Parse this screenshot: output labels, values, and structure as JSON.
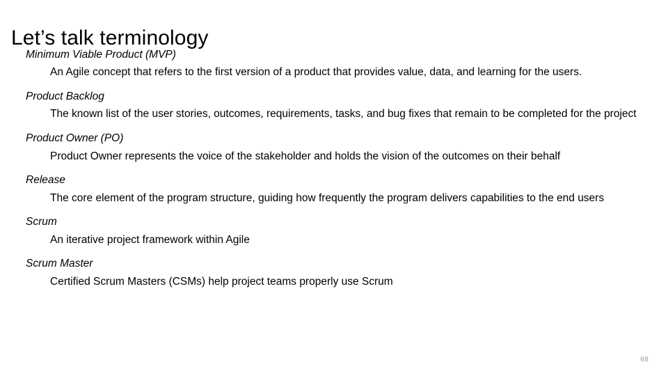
{
  "slide": {
    "title": "Let’s talk terminology",
    "page_number": "68",
    "text_color": "#000000",
    "background_color": "#ffffff",
    "page_number_color": "#9a9a9a",
    "terms": [
      {
        "term": "Minimum Viable Product (MVP)",
        "definition": "An Agile concept that refers to the first version of a product that provides value, data, and learning for the users."
      },
      {
        "term": "Product Backlog",
        "definition": "The known list of the user stories, outcomes, requirements, tasks, and bug fixes that remain to be completed for the project"
      },
      {
        "term": "Product Owner (PO)",
        "definition": "Product Owner represents the voice of the stakeholder and holds the vision of the outcomes on their behalf"
      },
      {
        "term": "Release",
        "definition": "The core element of the program structure, guiding how frequently the program delivers capabilities to the end users"
      },
      {
        "term": "Scrum",
        "definition": "An iterative project framework within Agile"
      },
      {
        "term": "Scrum Master",
        "definition": "Certified Scrum Masters (CSMs) help project teams properly use Scrum"
      }
    ]
  }
}
